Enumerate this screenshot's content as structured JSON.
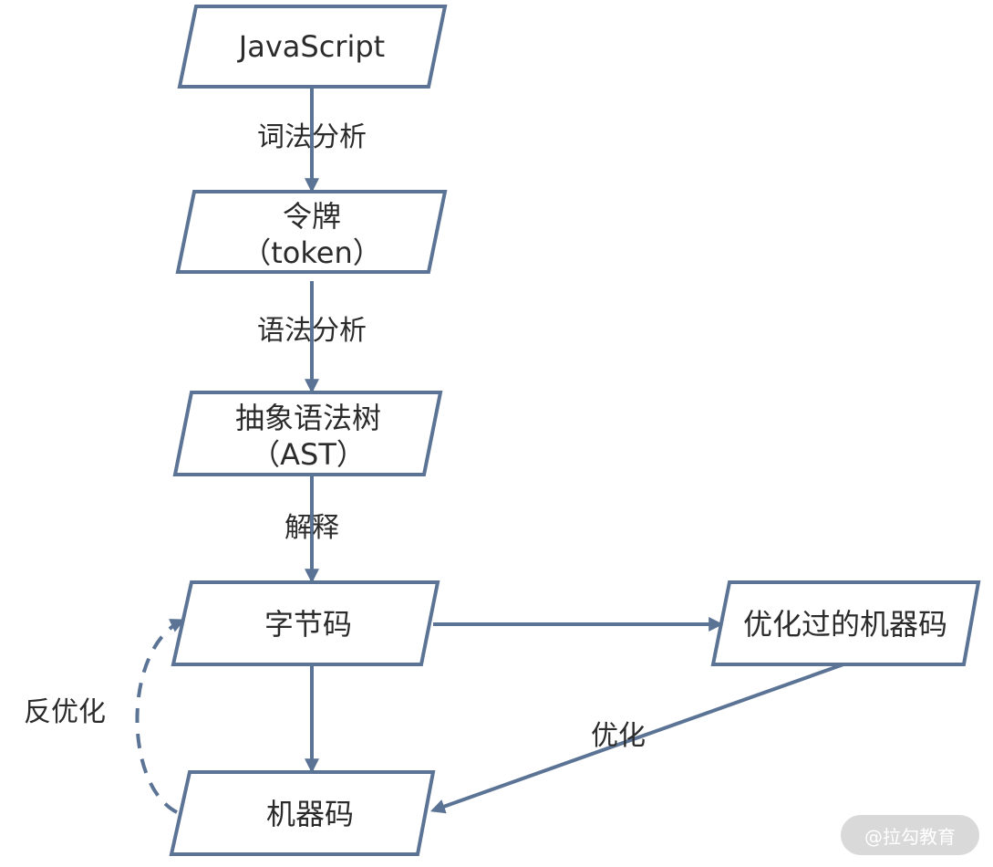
{
  "nodes": {
    "javascript": {
      "lines": [
        "JavaScript"
      ]
    },
    "token": {
      "lines": [
        "令牌",
        "（token）"
      ]
    },
    "ast": {
      "lines": [
        "抽象语法树",
        "（AST）"
      ]
    },
    "bytecode": {
      "lines": [
        "字节码"
      ]
    },
    "optimized": {
      "lines": [
        "优化过的机器码"
      ]
    },
    "machine": {
      "lines": [
        "机器码"
      ]
    }
  },
  "edges": {
    "lexical": "词法分析",
    "syntax": "语法分析",
    "interpret": "解释",
    "optimize": "优化",
    "deoptimize": "反优化"
  },
  "watermark": "@拉勾教育",
  "colors": {
    "stroke": "#5b7394",
    "text": "#2b2b2b",
    "watermark_bg": "#d9d9d9"
  }
}
